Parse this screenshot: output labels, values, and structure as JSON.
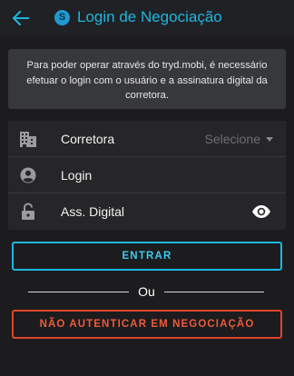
{
  "header": {
    "back_icon": "arrow-left-icon",
    "logo_letter": "S",
    "title": "Login de Negociação",
    "accent_color": "#1db6e0"
  },
  "info": {
    "message": "Para poder operar através do tryd.mobi, é necessário efetuar o login com o usuário e a assinatura digital da corretora."
  },
  "form": {
    "broker": {
      "icon": "building-icon",
      "label": "Corretora",
      "selected": "Selecione"
    },
    "login": {
      "icon": "account-circle-icon",
      "label": "Login",
      "value": ""
    },
    "signature": {
      "icon": "lock-open-icon",
      "label": "Ass. Digital",
      "value": "",
      "toggle_icon": "eye-icon"
    }
  },
  "actions": {
    "enter_label": "ENTRAR",
    "or_label": "Ou",
    "skip_label": "NÃO AUTENTICAR EM NEGOCIAÇÃO",
    "skip_color": "#e0452b"
  }
}
